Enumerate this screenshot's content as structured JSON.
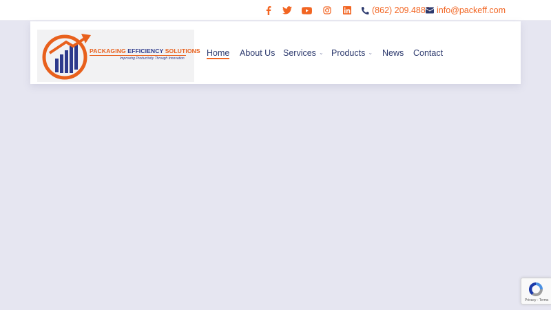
{
  "topbar": {
    "social": [
      {
        "name": "facebook"
      },
      {
        "name": "twitter"
      },
      {
        "name": "youtube"
      },
      {
        "name": "instagram"
      },
      {
        "name": "linkedin"
      }
    ],
    "phone": "(862) 209.4882",
    "email": "info@packeff.com"
  },
  "logo": {
    "title_orange": "PACKAGING ",
    "title_blue": "EFFICIENCY",
    "title_rest": " SOLUTIONS",
    "tagline": "Improving Productivity Through Innovation"
  },
  "nav": {
    "items": [
      {
        "label": "Home",
        "active": true,
        "dropdown": false
      },
      {
        "label": "About Us",
        "active": false,
        "dropdown": false
      },
      {
        "label": "Services",
        "active": false,
        "dropdown": true
      },
      {
        "label": "Products",
        "active": false,
        "dropdown": true
      },
      {
        "label": "News",
        "active": false,
        "dropdown": false
      },
      {
        "label": "Contact",
        "active": false,
        "dropdown": false
      }
    ]
  },
  "recaptcha": {
    "links": "Privacy - Terms"
  },
  "colors": {
    "accent": "#f26522",
    "nav_text": "#2d3a6e",
    "page_bg": "#e6e6f1",
    "brand_blue": "#2d3a8c"
  }
}
